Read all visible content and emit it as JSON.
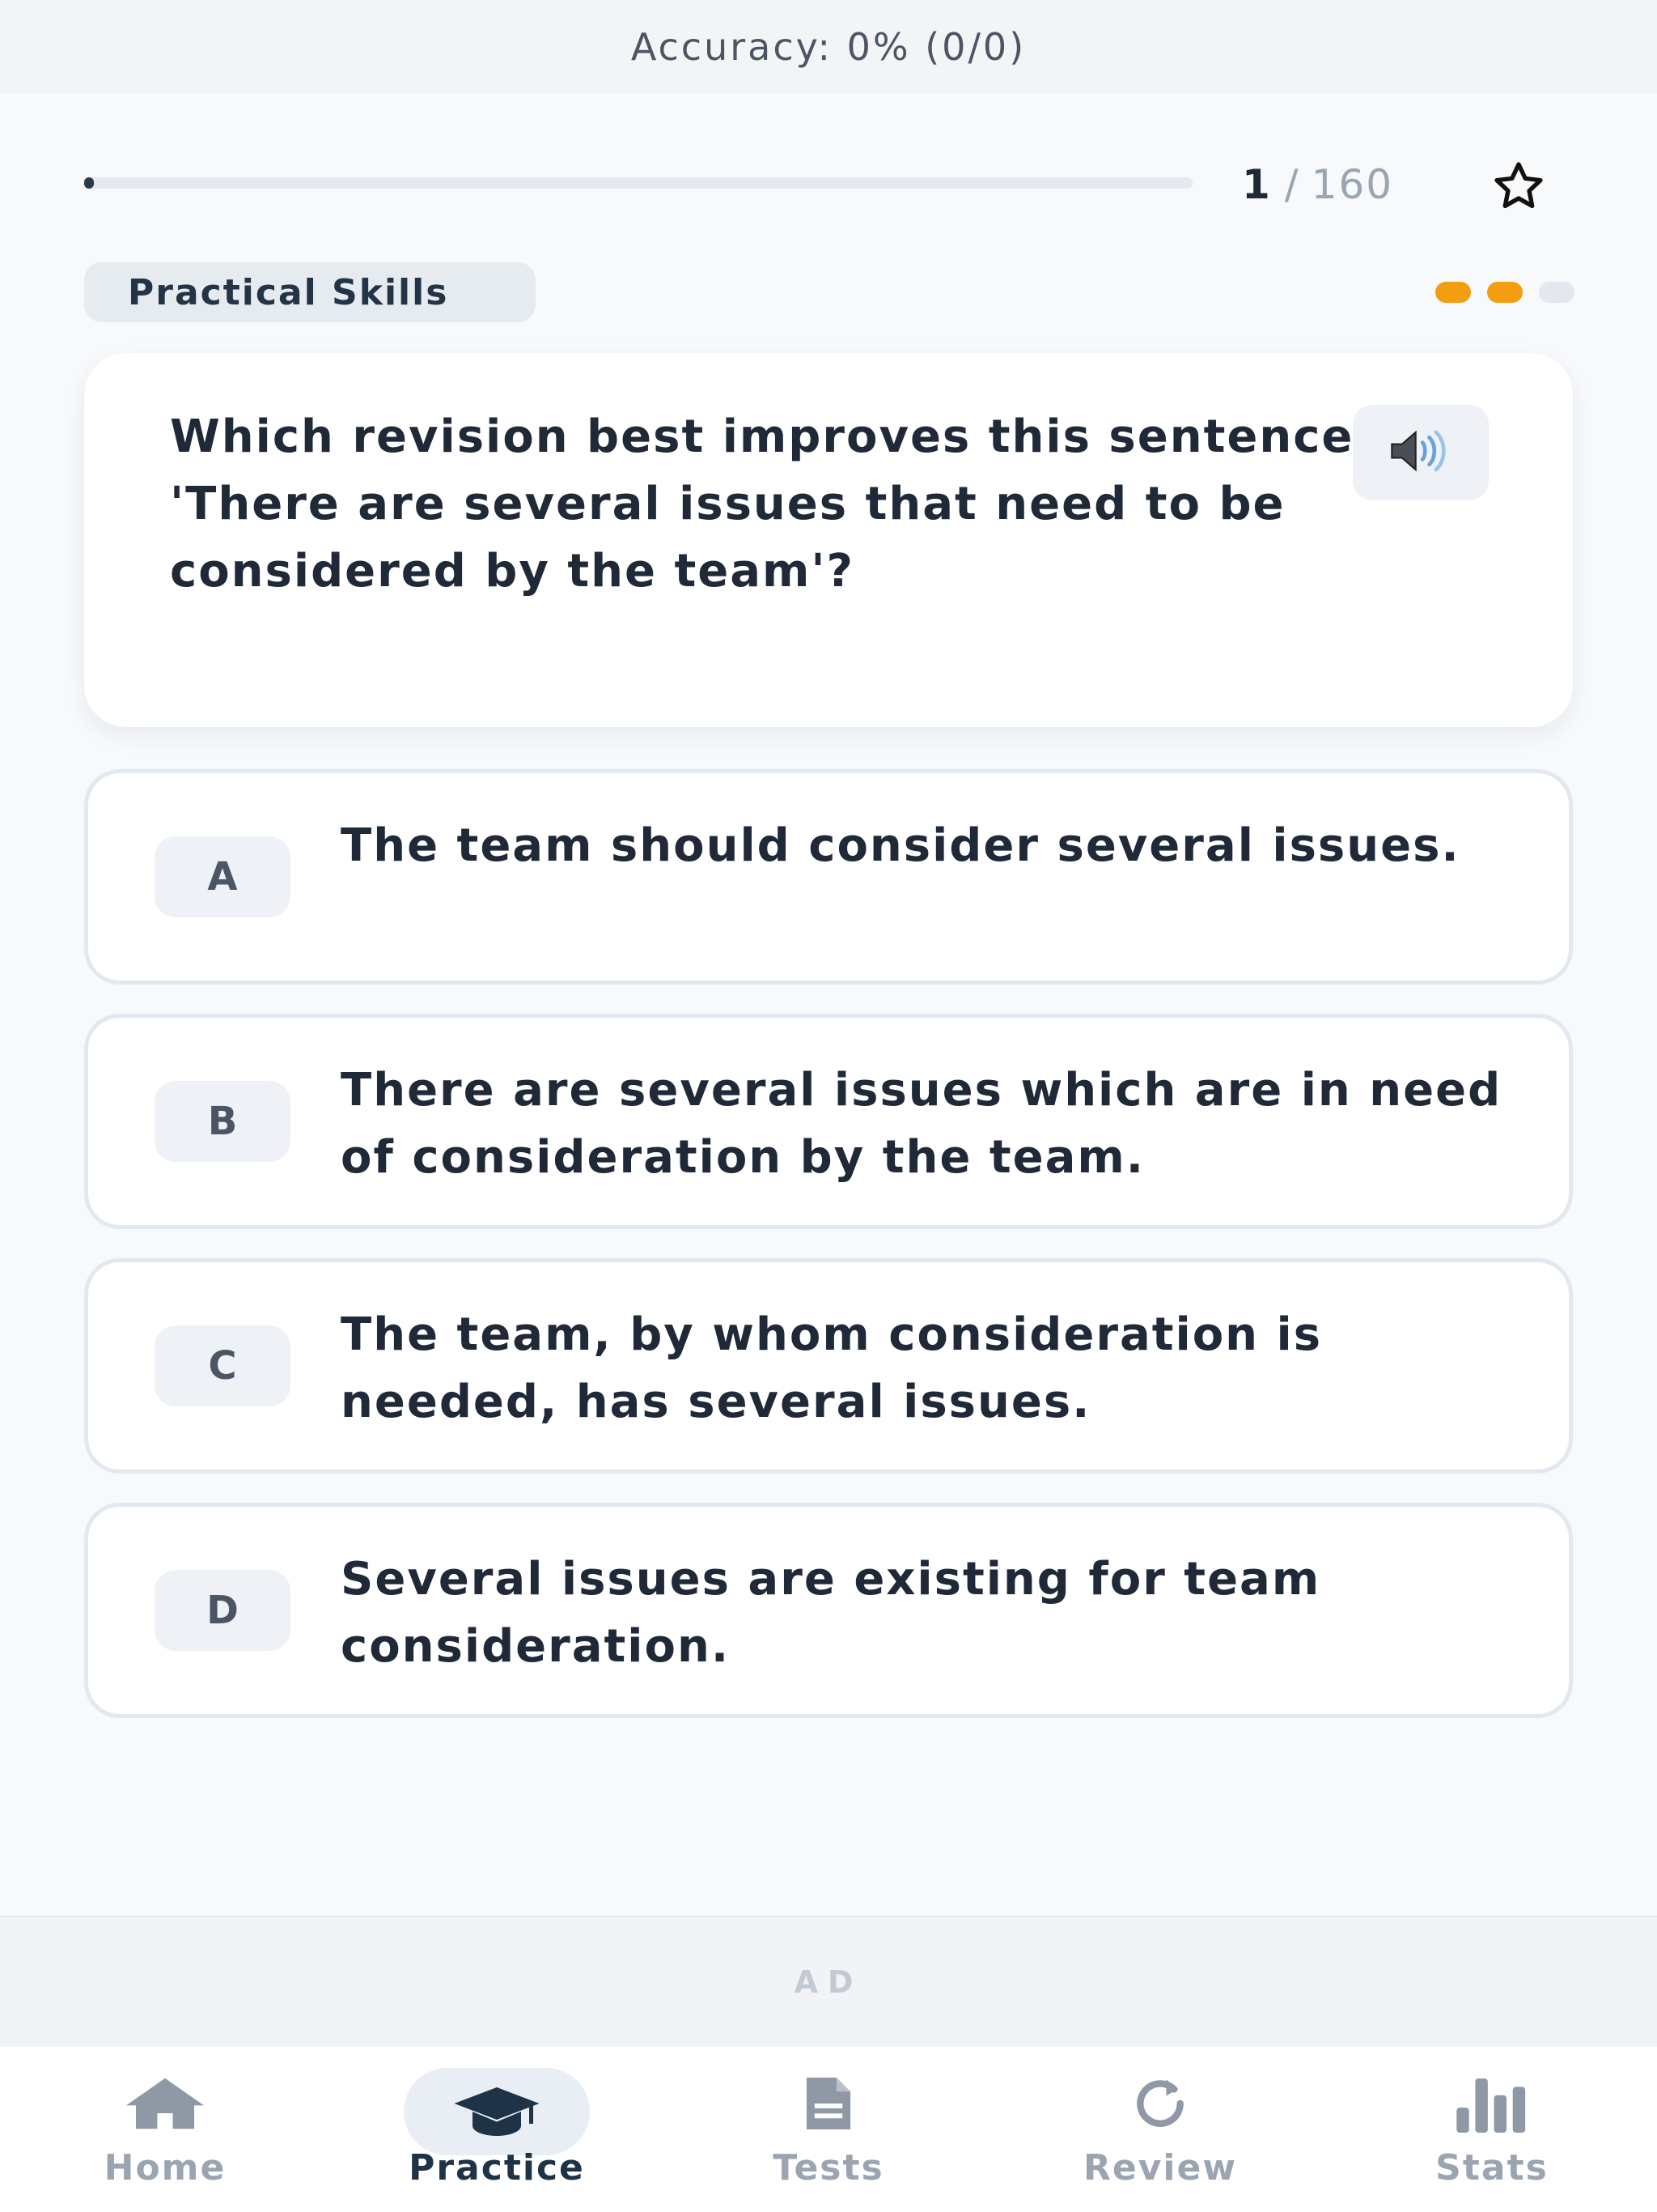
{
  "accuracy": {
    "text": "Accuracy: 0% (0/0)"
  },
  "progress": {
    "current": "1",
    "separator": "/",
    "total": "160",
    "fraction": 0.00625
  },
  "category": {
    "label": "Practical Skills"
  },
  "difficulty": {
    "level": 2,
    "max": 3,
    "active_color": "#f29e10"
  },
  "question": {
    "text": "Which revision best improves this sentence: 'There are several issues that need to be considered by the team'?",
    "audio_icon": "speaker-icon"
  },
  "options": [
    {
      "letter": "A",
      "text": "The team should consider several issues."
    },
    {
      "letter": "B",
      "text": "There are several issues which are in need of consideration by the team."
    },
    {
      "letter": "C",
      "text": "The team, by whom consideration is needed, has several issues."
    },
    {
      "letter": "D",
      "text": "Several issues are existing for team consideration."
    }
  ],
  "ad": {
    "label": "AD"
  },
  "nav": {
    "items": [
      {
        "label": "Home",
        "icon": "home-icon"
      },
      {
        "label": "Practice",
        "icon": "graduation-cap-icon",
        "active": true
      },
      {
        "label": "Tests",
        "icon": "document-icon"
      },
      {
        "label": "Review",
        "icon": "refresh-icon"
      },
      {
        "label": "Stats",
        "icon": "bar-chart-icon"
      }
    ]
  }
}
